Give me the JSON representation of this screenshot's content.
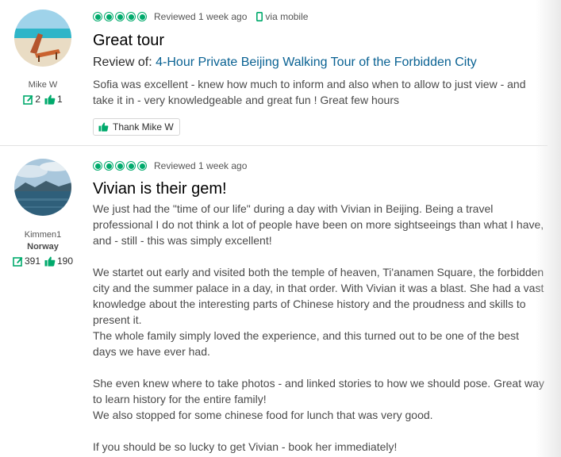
{
  "colors": {
    "accent": "#00aa6c",
    "link": "#0a6293",
    "title": "#000000"
  },
  "reviews": [
    {
      "user": {
        "name": "Mike W",
        "location": "",
        "contributions": "2",
        "helpful_votes": "1"
      },
      "rating": 5,
      "date": "Reviewed 1 week ago",
      "via_mobile": "via mobile",
      "title": "Great tour",
      "review_of_label": "Review of: ",
      "review_of_link": "4-Hour Private Beijing Walking Tour of the Forbidden City",
      "body": [
        "Sofia was excellent - knew how much to inform and also when to allow to just view - and take it in - very knowledgeable and great fun ! Great few hours"
      ],
      "thank_label": "Thank Mike W"
    },
    {
      "user": {
        "name": "Kimmen1",
        "location": "Norway",
        "contributions": "391",
        "helpful_votes": "190"
      },
      "rating": 5,
      "date": "Reviewed 1 week ago",
      "title": "Vivian is their gem!",
      "body": [
        "We just had the \"time of our life\" during a day with Vivian in Beijing. Being a travel professional I do not think a lot of people have been on more sightseeings than what I have, and - still - this was simply excellent!",
        "We startet out early and visited both the temple of heaven, Ti'anamen Square, the forbidden city and the summer palace in a day, in that order. With Vivian it was a blast. She had a vast knowledge about the interesting parts of Chinese history and the proudness and skills to present it.",
        "The whole family simply loved the experience, and this turned out to be one of the best days we have ever had.",
        "She even knew where to take photos - and linked stories to how we should pose. Great way to learn history for the entire family!",
        "We also stopped for some chinese food for lunch that was very good.",
        "If you should be so lucky to get Vivian - book her immediately!"
      ]
    }
  ]
}
